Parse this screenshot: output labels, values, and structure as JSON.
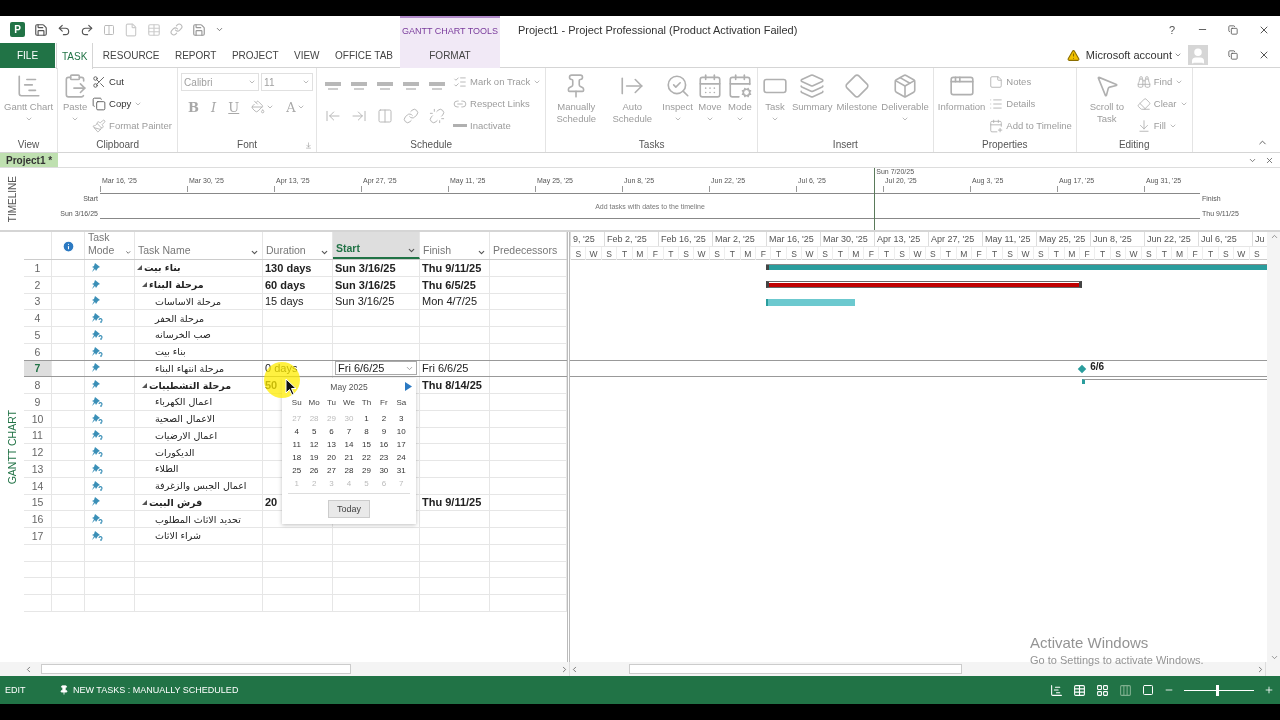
{
  "title_bar": {
    "app_logo": "P",
    "contextual_tab": "GANTT CHART TOOLS",
    "title": "Project1 - Project Professional (Product Activation Failed)",
    "help": "?"
  },
  "tabs": [
    {
      "label": "FILE",
      "kind": "file",
      "selected": false
    },
    {
      "label": "TASK",
      "kind": "normal",
      "selected": true
    },
    {
      "label": "RESOURCE",
      "kind": "normal",
      "selected": false
    },
    {
      "label": "REPORT",
      "kind": "normal",
      "selected": false
    },
    {
      "label": "PROJECT",
      "kind": "normal",
      "selected": false
    },
    {
      "label": "VIEW",
      "kind": "normal",
      "selected": false
    },
    {
      "label": "OFFICE TAB",
      "kind": "normal",
      "selected": false
    },
    {
      "label": "FORMAT",
      "kind": "contextual",
      "selected": false
    }
  ],
  "account": {
    "label": "Microsoft account",
    "warning": true
  },
  "ribbon": {
    "groups": [
      {
        "label": "View",
        "kind": "buttons",
        "launcher": false,
        "items": [
          {
            "kind": "large",
            "label": "Gantt Chart",
            "dropdown": true,
            "disabled": true
          }
        ]
      },
      {
        "label": "Clipboard",
        "kind": "buttons",
        "launcher": false,
        "items": [
          {
            "kind": "large",
            "label": "Paste",
            "dropdown": true,
            "disabled": true
          },
          {
            "kind": "small",
            "label": "Cut",
            "dropdown": false,
            "disabled": false
          },
          {
            "kind": "small",
            "label": "Copy",
            "dropdown": true,
            "disabled": false
          },
          {
            "kind": "small",
            "label": "Format Painter",
            "dropdown": false,
            "disabled": true
          }
        ]
      },
      {
        "label": "Font",
        "kind": "font",
        "launcher": true,
        "items": [
          {
            "kind": "field",
            "label": "Calibri",
            "dropdown": true,
            "disabled": true
          },
          {
            "kind": "field",
            "label": "11",
            "dropdown": true,
            "disabled": true
          },
          {
            "kind": "bold",
            "label": "B",
            "dropdown": false,
            "disabled": true
          },
          {
            "kind": "italic",
            "label": "I",
            "dropdown": false,
            "disabled": true
          },
          {
            "kind": "underline",
            "label": "U",
            "dropdown": false,
            "disabled": true
          },
          {
            "kind": "fill",
            "dropdown": true,
            "disabled": true
          },
          {
            "kind": "color",
            "label": "A",
            "dropdown": true,
            "disabled": true
          }
        ]
      },
      {
        "label": "Schedule",
        "kind": "schedule",
        "launcher": false,
        "items": [
          {
            "kind": "tool",
            "disabled": true
          },
          {
            "kind": "tool",
            "disabled": true
          },
          {
            "kind": "tool",
            "disabled": true
          },
          {
            "kind": "tool",
            "disabled": true
          },
          {
            "kind": "tool",
            "disabled": true
          },
          {
            "kind": "tool",
            "disabled": true
          },
          {
            "kind": "tool",
            "disabled": true
          },
          {
            "kind": "tool",
            "disabled": true
          },
          {
            "kind": "tool",
            "disabled": true
          },
          {
            "kind": "tool",
            "disabled": true
          },
          {
            "kind": "small",
            "label": "Mark on Track",
            "dropdown": true,
            "disabled": true
          },
          {
            "kind": "small",
            "label": "Respect Links",
            "dropdown": false,
            "disabled": true
          },
          {
            "kind": "small",
            "label": "Inactivate",
            "dropdown": false,
            "disabled": true
          }
        ]
      },
      {
        "label": "Tasks",
        "kind": "buttons",
        "launcher": false,
        "items": [
          {
            "kind": "large",
            "label": "Manually Schedule",
            "dropdown": false,
            "disabled": true
          },
          {
            "kind": "large",
            "label": "Auto Schedule",
            "dropdown": false,
            "disabled": true
          },
          {
            "kind": "large",
            "label": "Inspect",
            "dropdown": true,
            "disabled": true
          },
          {
            "kind": "large",
            "label": "Move",
            "dropdown": true,
            "disabled": true
          },
          {
            "kind": "large",
            "label": "Mode",
            "dropdown": true,
            "disabled": true
          }
        ]
      },
      {
        "label": "Insert",
        "kind": "buttons",
        "launcher": false,
        "items": [
          {
            "kind": "large",
            "label": "Task",
            "dropdown": true,
            "disabled": true
          },
          {
            "kind": "large",
            "label": "Summary",
            "dropdown": false,
            "disabled": true
          },
          {
            "kind": "large",
            "label": "Milestone",
            "dropdown": false,
            "disabled": true
          },
          {
            "kind": "large",
            "label": "Deliverable",
            "dropdown": true,
            "disabled": true
          }
        ]
      },
      {
        "label": "Properties",
        "kind": "buttons",
        "launcher": false,
        "items": [
          {
            "kind": "large",
            "label": "Information",
            "dropdown": false,
            "disabled": true
          },
          {
            "kind": "small",
            "label": "Notes",
            "dropdown": false,
            "disabled": true
          },
          {
            "kind": "small",
            "label": "Details",
            "dropdown": false,
            "disabled": true
          },
          {
            "kind": "small",
            "label": "Add to Timeline",
            "dropdown": false,
            "disabled": true
          }
        ]
      },
      {
        "label": "Editing",
        "kind": "buttons",
        "launcher": false,
        "items": [
          {
            "kind": "large",
            "label": "Scroll to Task",
            "dropdown": false,
            "disabled": true
          },
          {
            "kind": "small",
            "label": "Find",
            "dropdown": true,
            "disabled": true
          },
          {
            "kind": "small",
            "label": "Clear",
            "dropdown": true,
            "disabled": true
          },
          {
            "kind": "small",
            "label": "Fill",
            "dropdown": true,
            "disabled": true
          }
        ]
      }
    ]
  },
  "document_tab": {
    "label": "Project1 *"
  },
  "timeline": {
    "side_label": "TIMELINE",
    "today": "Sun 7/20/25",
    "start_label": "Start",
    "start": "Sun 3/16/25",
    "finish_label": "Finish",
    "finish": "Thu 9/11/25",
    "hint": "Add tasks with dates to the timeline",
    "ticks": [
      "Mar 16, '25",
      "Mar 30, '25",
      "Apr 13, '25",
      "Apr 27, '25",
      "May 11, '25",
      "May 25, '25",
      "Jun 8, '25",
      "Jun 22, '25",
      "Jul 6, '25",
      "Jul 20, '25",
      "Aug 3, '25",
      "Aug 17, '25",
      "Aug 31, '25"
    ]
  },
  "view_label": "GANTT CHART",
  "table": {
    "columns": [
      {
        "kind": "info",
        "filter": false,
        "selected": false
      },
      {
        "kind": "mode",
        "label": "Task Mode",
        "filter": true,
        "selected": false
      },
      {
        "kind": "name",
        "label": "Task Name",
        "filter": true,
        "selected": false
      },
      {
        "kind": "duration",
        "label": "Duration",
        "filter": true,
        "selected": false
      },
      {
        "kind": "start",
        "label": "Start",
        "filter": true,
        "selected": true
      },
      {
        "kind": "finish",
        "label": "Finish",
        "filter": true,
        "selected": false
      },
      {
        "kind": "predecessors",
        "label": "Predecessors",
        "filter": false,
        "selected": false
      }
    ],
    "rows": [
      {
        "id": "1",
        "name": "بناء بيت",
        "summary": true,
        "expanded": true,
        "estimated": false,
        "selected": false,
        "editing": false,
        "duration": "130 days",
        "start": "Sun 3/16/25",
        "finish": "Thu 9/11/25",
        "bar": {
          "kind": "summary"
        },
        "children": [
          {
            "id": "2",
            "name": "مرحلة البناء",
            "summary": true,
            "expanded": true,
            "estimated": false,
            "selected": false,
            "editing": false,
            "duration": "60 days",
            "start": "Sun 3/16/25",
            "finish": "Thu 6/5/25",
            "bar": {
              "kind": "critical-summary"
            },
            "children": [
              {
                "id": "3",
                "name": "مرحلة الاساسات",
                "summary": false,
                "estimated": false,
                "selected": false,
                "editing": false,
                "duration": "15 days",
                "start": "Sun 3/16/25",
                "finish": "Mon 4/7/25",
                "bar": {
                  "kind": "manual"
                }
              },
              {
                "id": "4",
                "name": "مرحلة الحفر",
                "summary": false,
                "estimated": true,
                "selected": false,
                "editing": false
              },
              {
                "id": "5",
                "name": "صب الخرسانه",
                "summary": false,
                "estimated": true,
                "selected": false,
                "editing": false
              },
              {
                "id": "6",
                "name": "بناء بيت",
                "summary": false,
                "estimated": true,
                "selected": false,
                "editing": false
              },
              {
                "id": "7",
                "name": "مرحلة انتهاء البناء",
                "summary": false,
                "estimated": false,
                "selected": true,
                "editing": true,
                "duration": "0 days",
                "start": "Fri 6/6/25",
                "finish": "Fri 6/6/25",
                "bar": {
                  "kind": "milestone",
                  "label": "6/6"
                }
              }
            ]
          },
          {
            "id": "8",
            "name": "مرحلة التشطيبات",
            "summary": true,
            "expanded": true,
            "estimated": false,
            "selected": false,
            "editing": false,
            "duration": "50",
            "finish": "Thu 8/14/25",
            "bar": {
              "kind": "manual-summary"
            },
            "children": [
              {
                "id": "9",
                "name": "اعمال الكهرباء",
                "summary": false,
                "estimated": true,
                "selected": false,
                "editing": false
              },
              {
                "id": "10",
                "name": "الاعمال الصحية",
                "summary": false,
                "estimated": true,
                "selected": false,
                "editing": false
              },
              {
                "id": "11",
                "name": "اعمال الارضيات",
                "summary": false,
                "estimated": true,
                "selected": false,
                "editing": false
              },
              {
                "id": "12",
                "name": "الديكورات",
                "summary": false,
                "estimated": true,
                "selected": false,
                "editing": false
              },
              {
                "id": "13",
                "name": "الطلاء",
                "summary": false,
                "estimated": true,
                "selected": false,
                "editing": false
              },
              {
                "id": "14",
                "name": "اعمال الجبس والزغرفة",
                "summary": false,
                "estimated": true,
                "selected": false,
                "editing": false
              }
            ]
          },
          {
            "id": "15",
            "name": "فرش البيت",
            "summary": true,
            "expanded": true,
            "estimated": false,
            "selected": false,
            "editing": false,
            "duration": "20",
            "finish": "Thu 9/11/25",
            "children": [
              {
                "id": "16",
                "name": "تحديد الاثاث المطلوب",
                "summary": false,
                "estimated": true,
                "selected": false,
                "editing": false
              },
              {
                "id": "17",
                "name": "شراء الاثاث",
                "summary": false,
                "estimated": true,
                "selected": false,
                "editing": false
              }
            ]
          }
        ]
      }
    ]
  },
  "gantt": {
    "major": [
      "9, '25",
      "Feb 2, '25",
      "Feb 16, '25",
      "Mar 2, '25",
      "Mar 16, '25",
      "Mar 30, '25",
      "Apr 13, '25",
      "Apr 27, '25",
      "May 11, '25",
      "May 25, '25",
      "Jun 8, '25",
      "Jun 22, '25",
      "Jul 6, '25",
      "Ju"
    ],
    "minor": [
      "S",
      "W",
      "S",
      "T",
      "M",
      "F",
      "T",
      "S",
      "W",
      "S",
      "T",
      "M",
      "F",
      "T",
      "S",
      "W",
      "S",
      "T",
      "M",
      "F",
      "T",
      "S",
      "W",
      "S",
      "T",
      "M",
      "F",
      "T",
      "S",
      "W",
      "S",
      "T",
      "M",
      "F",
      "T",
      "S",
      "W",
      "S",
      "T",
      "M",
      "F",
      "T",
      "S",
      "W",
      "S"
    ]
  },
  "calendar": {
    "month": "May 2025",
    "weekdays": [
      "Su",
      "Mo",
      "Tu",
      "We",
      "Th",
      "Fr",
      "Sa"
    ],
    "today": "Today",
    "days": [
      {
        "label": "27",
        "muted": true
      },
      {
        "label": "28",
        "muted": true
      },
      {
        "label": "29",
        "muted": true
      },
      {
        "label": "30",
        "muted": true
      },
      {
        "label": "1",
        "muted": false
      },
      {
        "label": "2",
        "muted": false
      },
      {
        "label": "3",
        "muted": false
      },
      {
        "label": "4",
        "muted": false
      },
      {
        "label": "5",
        "muted": false
      },
      {
        "label": "6",
        "muted": false
      },
      {
        "label": "7",
        "muted": false
      },
      {
        "label": "8",
        "muted": false
      },
      {
        "label": "9",
        "muted": false
      },
      {
        "label": "10",
        "muted": false
      },
      {
        "label": "11",
        "muted": false
      },
      {
        "label": "12",
        "muted": false
      },
      {
        "label": "13",
        "muted": false
      },
      {
        "label": "14",
        "muted": false
      },
      {
        "label": "15",
        "muted": false
      },
      {
        "label": "16",
        "muted": false
      },
      {
        "label": "17",
        "muted": false
      },
      {
        "label": "18",
        "muted": false
      },
      {
        "label": "19",
        "muted": false
      },
      {
        "label": "20",
        "muted": false
      },
      {
        "label": "21",
        "muted": false
      },
      {
        "label": "22",
        "muted": false
      },
      {
        "label": "23",
        "muted": false
      },
      {
        "label": "24",
        "muted": false
      },
      {
        "label": "25",
        "muted": false
      },
      {
        "label": "26",
        "muted": false
      },
      {
        "label": "27",
        "muted": false
      },
      {
        "label": "28",
        "muted": false
      },
      {
        "label": "29",
        "muted": false
      },
      {
        "label": "30",
        "muted": false
      },
      {
        "label": "31",
        "muted": false
      },
      {
        "label": "1",
        "muted": true
      },
      {
        "label": "2",
        "muted": true
      },
      {
        "label": "3",
        "muted": true
      },
      {
        "label": "4",
        "muted": true
      },
      {
        "label": "5",
        "muted": true
      },
      {
        "label": "6",
        "muted": true
      },
      {
        "label": "7",
        "muted": true
      }
    ]
  },
  "status_bar": {
    "mode": "EDIT",
    "new_tasks": "NEW TASKS : MANUALLY SCHEDULED",
    "zoom": {
      "level": 0.47
    }
  },
  "activation_notice": {
    "title": "Activate Windows",
    "hint": "Go to Settings to activate Windows."
  }
}
